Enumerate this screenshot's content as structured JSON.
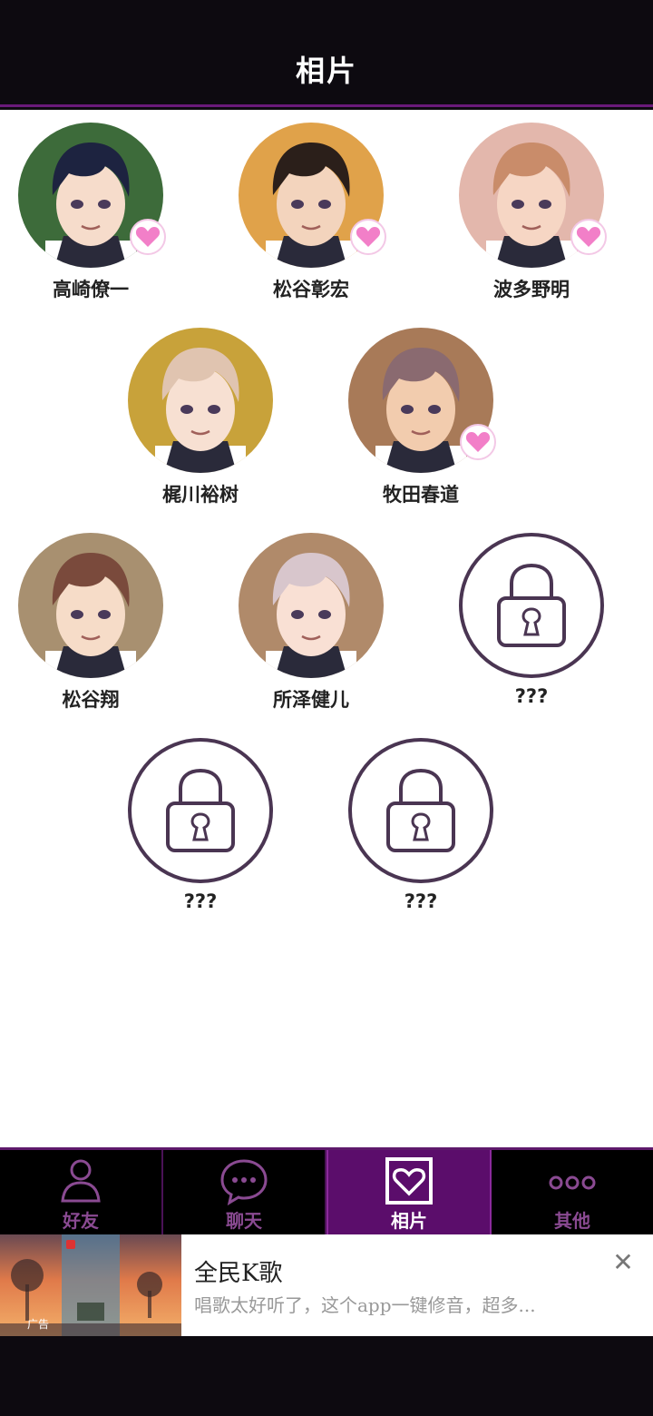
{
  "header": {
    "title": "相片"
  },
  "characters": [
    {
      "name": "高崎僚一",
      "liked": true,
      "locked": false,
      "skin": "#f6dccb",
      "hair": "#1d2340",
      "bg": "#3d6b3a"
    },
    {
      "name": "松谷彰宏",
      "liked": true,
      "locked": false,
      "skin": "#f3d4bd",
      "hair": "#2b1f1a",
      "bg": "#e0a24a"
    },
    {
      "name": "波多野明",
      "liked": true,
      "locked": false,
      "skin": "#f6d6c4",
      "hair": "#c98c6a",
      "bg": "#e3b7ac"
    },
    {
      "name": "梶川裕树",
      "liked": false,
      "locked": false,
      "skin": "#f7e0d2",
      "hair": "#e0c4b0",
      "bg": "#c8a23a"
    },
    {
      "name": "牧田春道",
      "liked": true,
      "locked": false,
      "skin": "#f2ccae",
      "hair": "#8a6a70",
      "bg": "#a87a58"
    },
    {
      "name": "松谷翔",
      "liked": false,
      "locked": false,
      "skin": "#f6dcc8",
      "hair": "#7a4a3c",
      "bg": "#a89070"
    },
    {
      "name": "所泽健儿",
      "liked": false,
      "locked": false,
      "skin": "#f9e0d4",
      "hair": "#d8c6cc",
      "bg": "#b08a6a"
    },
    {
      "name": "???",
      "liked": false,
      "locked": true
    },
    {
      "name": "???",
      "liked": false,
      "locked": true
    },
    {
      "name": "???",
      "liked": false,
      "locked": true
    }
  ],
  "tabs": [
    {
      "label": "好友",
      "icon": "person-icon",
      "active": false
    },
    {
      "label": "聊天",
      "icon": "chat-bubble-icon",
      "active": false
    },
    {
      "label": "相片",
      "icon": "photo-heart-icon",
      "active": true
    },
    {
      "label": "其他",
      "icon": "more-dots-icon",
      "active": false
    }
  ],
  "ad": {
    "title": "全民K歌",
    "description": "唱歌太好听了，这个app一键修音，超多...",
    "tag": "广告",
    "close_icon": "close-icon"
  },
  "colors": {
    "accent": "#5b0d6b",
    "lock_ring": "#4a3552",
    "heart": "#f27fc8"
  }
}
